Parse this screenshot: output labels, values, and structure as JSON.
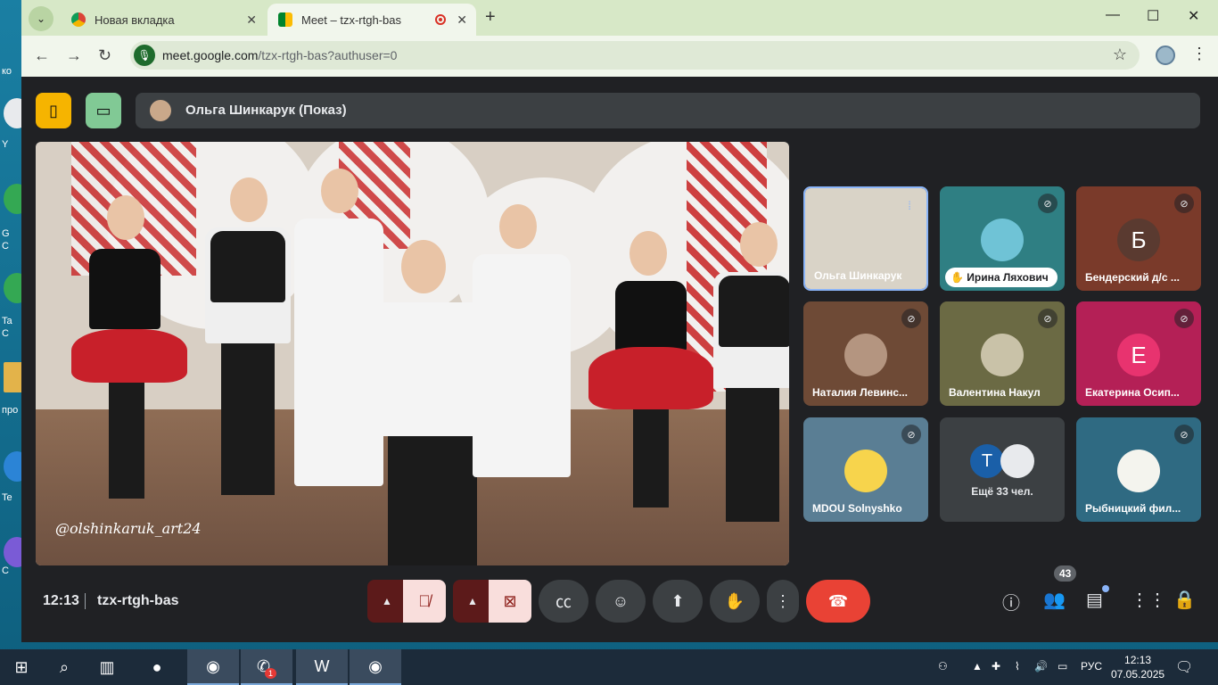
{
  "browser": {
    "tabs": [
      {
        "label": "Новая вкладка"
      },
      {
        "label": "Meet – tzx-rtgh-bas"
      }
    ],
    "url_host": "meet.google.com",
    "url_path": "/tzx-rtgh-bas?authuser=0"
  },
  "desktop": {
    "labels": [
      "ко",
      "Y",
      "G",
      "C",
      "Ta",
      "C",
      "про",
      "Te",
      "C"
    ]
  },
  "meet": {
    "presenter": "Ольга Шинкарук (Показ)",
    "watermark": "@olshinkaruk_art24",
    "tiles": [
      {
        "name": "Ольга Шинкарук",
        "state": "speaking",
        "color": "#d9d3c7"
      },
      {
        "name": "Ирина Ляхович",
        "state": "hand",
        "color": "#2f7f83"
      },
      {
        "name": "Бендерский д/с ...",
        "letter": "Б",
        "color": "#7a3a2a"
      },
      {
        "name": "Наталия Левинс...",
        "color": "#6e4a36"
      },
      {
        "name": "Валентина Накул",
        "color": "#6b6a44"
      },
      {
        "name": "Екатерина Осип...",
        "letter": "Е",
        "color": "#b42056"
      },
      {
        "name": "MDOU Solnyshko",
        "color": "#5a7e94"
      },
      {
        "name": "Ещё 33 чел.",
        "letter": "Т"
      },
      {
        "name": "Рыбницкий фил...",
        "color": "#2f6a82"
      }
    ],
    "clock": "12:13",
    "meeting_code": "tzx-rtgh-bas",
    "participants_count": "43",
    "hangup_color": "#e94235"
  },
  "taskbar": {
    "lang": "РУС",
    "time": "12:13",
    "date": "07.05.2025",
    "viber_badge": "1"
  }
}
